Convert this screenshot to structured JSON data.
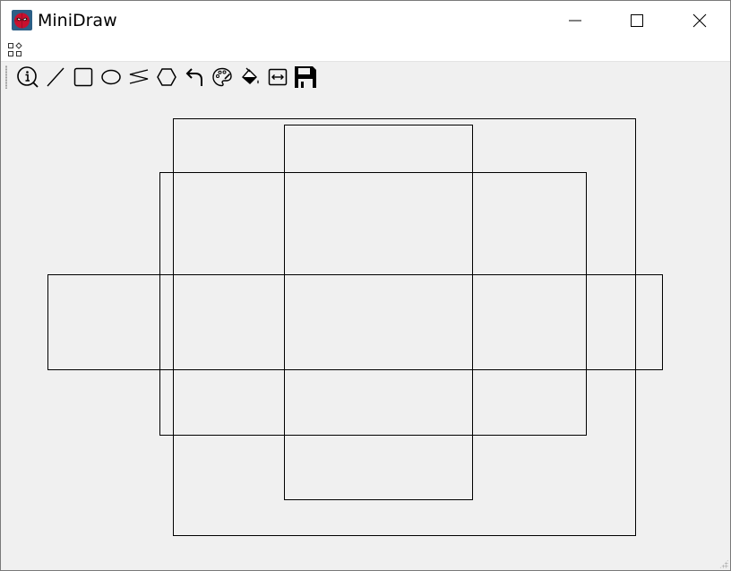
{
  "window": {
    "title": "MiniDraw",
    "icon": "spiderman-app-icon"
  },
  "window_controls": [
    "minimize-icon",
    "maximize-icon",
    "close-icon"
  ],
  "menubar": {
    "icon": "shapes-menu-icon"
  },
  "toolbar": {
    "tools": [
      {
        "name": "about",
        "icon": "info-icon"
      },
      {
        "name": "line",
        "icon": "line-icon"
      },
      {
        "name": "rectangle",
        "icon": "rectangle-icon"
      },
      {
        "name": "ellipse",
        "icon": "ellipse-icon"
      },
      {
        "name": "freehand",
        "icon": "freehand-icon"
      },
      {
        "name": "polygon",
        "icon": "polygon-icon"
      },
      {
        "name": "undo",
        "icon": "undo-icon"
      },
      {
        "name": "color",
        "icon": "palette-icon"
      },
      {
        "name": "fill",
        "icon": "fill-bucket-icon"
      },
      {
        "name": "line-width",
        "icon": "line-width-icon"
      },
      {
        "name": "save",
        "icon": "save-icon"
      }
    ]
  },
  "canvas": {
    "background": "#f0f0f0",
    "stroke": "#000000",
    "shape_count": 4
  }
}
